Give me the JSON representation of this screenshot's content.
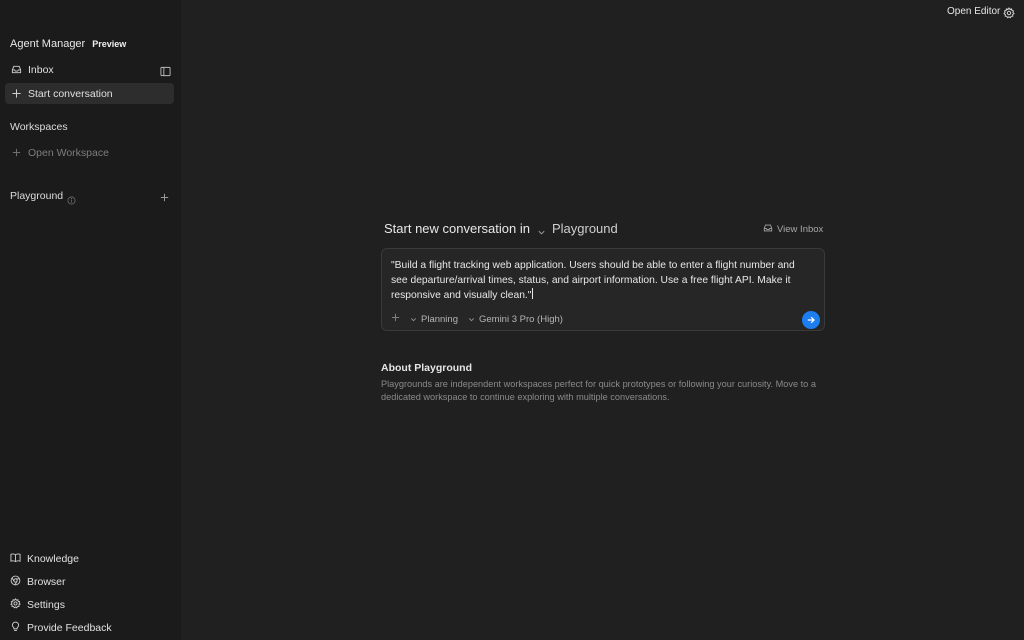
{
  "topbar": {
    "open_editor": "Open Editor",
    "settings_icon": "gear-icon"
  },
  "sidebar": {
    "title": "Agent Manager",
    "badge": "Preview",
    "inbox": "Inbox",
    "start_conversation": "Start conversation",
    "workspaces_title": "Workspaces",
    "open_workspace": "Open Workspace",
    "playground_title": "Playground",
    "bottom": {
      "knowledge": "Knowledge",
      "browser": "Browser",
      "settings": "Settings",
      "feedback": "Provide Feedback"
    }
  },
  "main": {
    "heading": "Start new conversation in",
    "target": "Playground",
    "view_inbox": "View Inbox",
    "prompt": "\"Build a flight tracking web application. Users should be able to enter a flight number and see departure/arrival times, status, and airport information. Use a free flight API. Make it responsive and visually clean.\"",
    "mode": "Planning",
    "model": "Gemini 3 Pro (High)",
    "about_title": "About Playground",
    "about_text": "Playgrounds are independent workspaces perfect for quick prototypes or following your curiosity. Move to a dedicated workspace to continue exploring with multiple conversations."
  },
  "colors": {
    "background": "#202020",
    "sidebar": "#1b1b1b",
    "accent": "#1d7ef0"
  }
}
